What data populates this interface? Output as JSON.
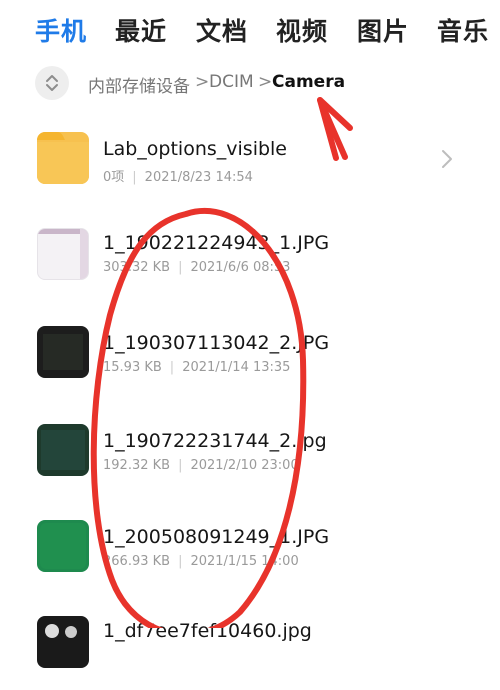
{
  "tabs": [
    {
      "label": "手机",
      "active": true
    },
    {
      "label": "最近",
      "active": false
    },
    {
      "label": "文档",
      "active": false
    },
    {
      "label": "视频",
      "active": false
    },
    {
      "label": "图片",
      "active": false
    },
    {
      "label": "音乐",
      "active": false
    }
  ],
  "breadcrumb": {
    "items": [
      "内部存储设备",
      "DCIM",
      "Camera"
    ],
    "separator": ">"
  },
  "files": [
    {
      "name": "Lab_options_visible",
      "size": "0项",
      "date": "2021/8/23 14:54",
      "type": "folder",
      "icon": "folder-icon"
    },
    {
      "name": "1_190221224943_1.JPG",
      "size": "303.32 KB",
      "date": "2021/6/6 08:53",
      "type": "image",
      "icon": "image-thumbnail"
    },
    {
      "name": "1_190307113042_2.JPG",
      "size": "15.93 KB",
      "date": "2021/1/14 13:35",
      "type": "image",
      "icon": "image-thumbnail"
    },
    {
      "name": "1_190722231744_2.jpg",
      "size": "192.32 KB",
      "date": "2021/2/10 23:00",
      "type": "image",
      "icon": "image-thumbnail"
    },
    {
      "name": "1_200508091249_1.JPG",
      "size": "266.93 KB",
      "date": "2021/1/15 14:00",
      "type": "image",
      "icon": "image-thumbnail"
    },
    {
      "name": "1_df7ee7fef10460.jpg",
      "size": "",
      "date": "",
      "type": "image",
      "icon": "image-thumbnail"
    }
  ],
  "colors": {
    "accent": "#1f7be8",
    "annotation": "#e8332b",
    "folder": "#f7c14f"
  }
}
